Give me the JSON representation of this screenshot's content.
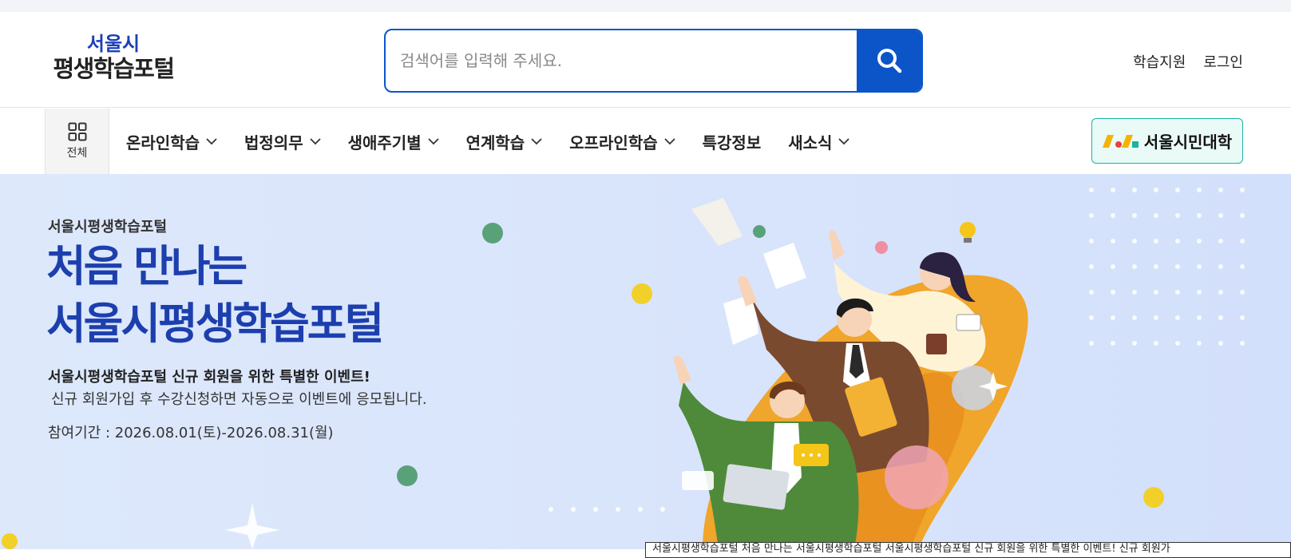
{
  "logo": {
    "line1": "서울시",
    "line2": "평생학습포털"
  },
  "search": {
    "placeholder": "검색어를 입력해 주세요.",
    "icon": "search-icon"
  },
  "util_links": [
    "학습지원",
    "로그인"
  ],
  "gnb": {
    "all_label": "전체",
    "items": [
      {
        "label": "온라인학습",
        "dropdown": true
      },
      {
        "label": "법정의무",
        "dropdown": true
      },
      {
        "label": "생애주기별",
        "dropdown": true
      },
      {
        "label": "연계학습",
        "dropdown": true
      },
      {
        "label": "오프라인학습",
        "dropdown": true
      },
      {
        "label": "특강정보",
        "dropdown": false
      },
      {
        "label": "새소식",
        "dropdown": true
      }
    ],
    "univ_label": "서울시민대학"
  },
  "banner": {
    "subtitle": "서울시평생학습포털",
    "title_line1": "처음 만나는",
    "title_line2": "서울시평생학습포털",
    "desc1": "서울시평생학습포털 신규 회원을 위한 특별한 이벤트!",
    "desc2": "신규 회원가입 후 수강신청하면 자동으로 이벤트에 응모됩니다.",
    "period": "참여기간 : 2026.08.01(토)-2026.08.31(월)"
  },
  "caption": "서울시평생학습포털 처음 만나는 서울시평생학습포털 서울시평생학습포털 신규 회원을 위한 특별한 이벤트! 신규 회원가",
  "colors": {
    "primary": "#0b55c9",
    "title_blue": "#1d3fae",
    "banner_bg": "#dbe6fb",
    "univ_border": "#1cb3a0"
  }
}
